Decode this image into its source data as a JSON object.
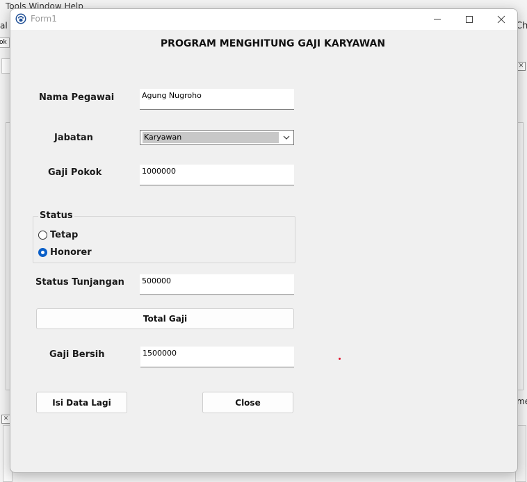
{
  "background": {
    "menu_fragment": "Tools  Window  Help",
    "left_fragment_1": "al",
    "left_fragment_2": "ok",
    "right_fragment_1": "Cha",
    "right_fragment_2": "me"
  },
  "window": {
    "title": "Form1",
    "icon": "paw-icon"
  },
  "form": {
    "heading": "PROGRAM MENGHITUNG GAJI KARYAWAN",
    "nama_label": "Nama Pegawai",
    "nama_value": "Agung Nugroho",
    "jabatan_label": "Jabatan",
    "jabatan_value": "Karyawan",
    "gaji_pokok_label": "Gaji Pokok",
    "gaji_pokok_value": "1000000",
    "status_group_title": "Status",
    "status_options": [
      {
        "label": "Tetap",
        "checked": false
      },
      {
        "label": "Honorer",
        "checked": true
      }
    ],
    "tunjangan_label": "Status Tunjangan",
    "tunjangan_value": "500000",
    "total_button": "Total Gaji",
    "gaji_bersih_label": "Gaji Bersih",
    "gaji_bersih_value": "1500000",
    "reset_button": "Isi Data Lagi",
    "close_button": "Close"
  },
  "colors": {
    "radio_checked": "#0a5fc8",
    "stray_dot": "#e0102a"
  }
}
